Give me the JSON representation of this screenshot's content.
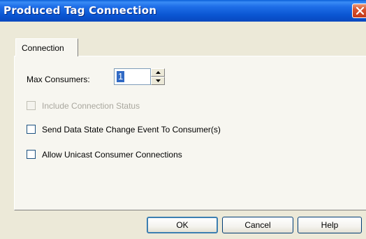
{
  "window": {
    "title": "Produced Tag Connection"
  },
  "tabs": [
    {
      "label": "Connection"
    }
  ],
  "fields": {
    "max_consumers": {
      "label": "Max Consumers:",
      "value": "1"
    }
  },
  "checkboxes": [
    {
      "label": "Include Connection Status",
      "checked": false,
      "enabled": false
    },
    {
      "label": "Send Data State Change Event To Consumer(s)",
      "checked": false,
      "enabled": true
    },
    {
      "label": "Allow Unicast Consumer Connections",
      "checked": false,
      "enabled": true
    }
  ],
  "buttons": {
    "ok": "OK",
    "cancel": "Cancel",
    "help": "Help"
  },
  "icons": {
    "close": "close-icon",
    "spin_up": "arrow-up-icon",
    "spin_down": "arrow-down-icon"
  },
  "colors": {
    "titlebar": "#0a55d2",
    "selection": "#316ac5",
    "close": "#d8522e"
  }
}
